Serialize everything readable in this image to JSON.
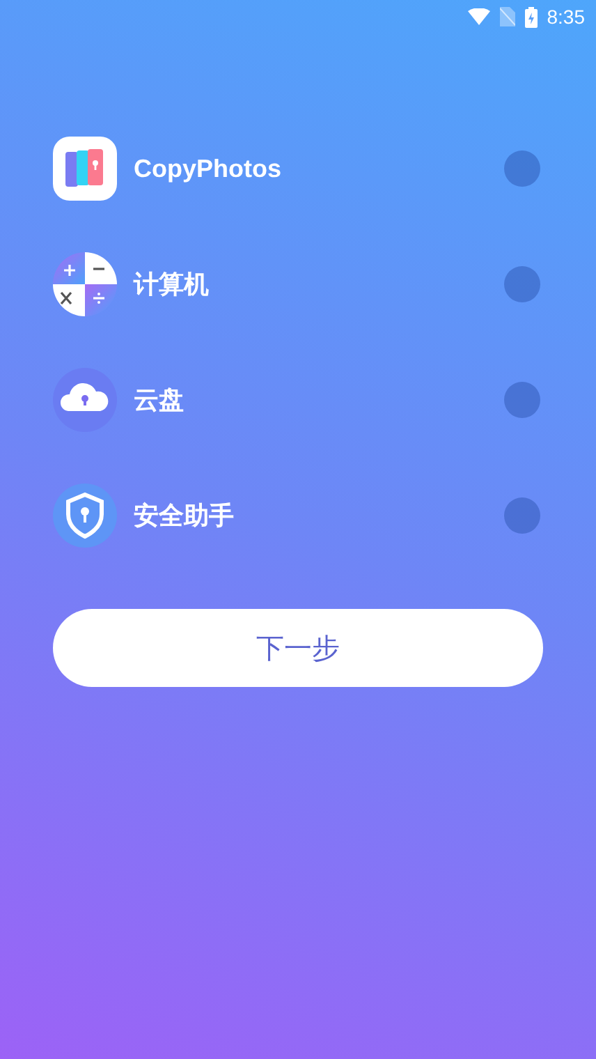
{
  "status_bar": {
    "time": "8:35"
  },
  "apps": [
    {
      "kind": "photos",
      "name": "CopyPhotos",
      "selected": false
    },
    {
      "kind": "calculator",
      "name": "计算机",
      "selected": false
    },
    {
      "kind": "cloud",
      "name": "云盘",
      "selected": false
    },
    {
      "kind": "shield",
      "name": "安全助手",
      "selected": false
    }
  ],
  "next_button": {
    "label": "下一步"
  }
}
